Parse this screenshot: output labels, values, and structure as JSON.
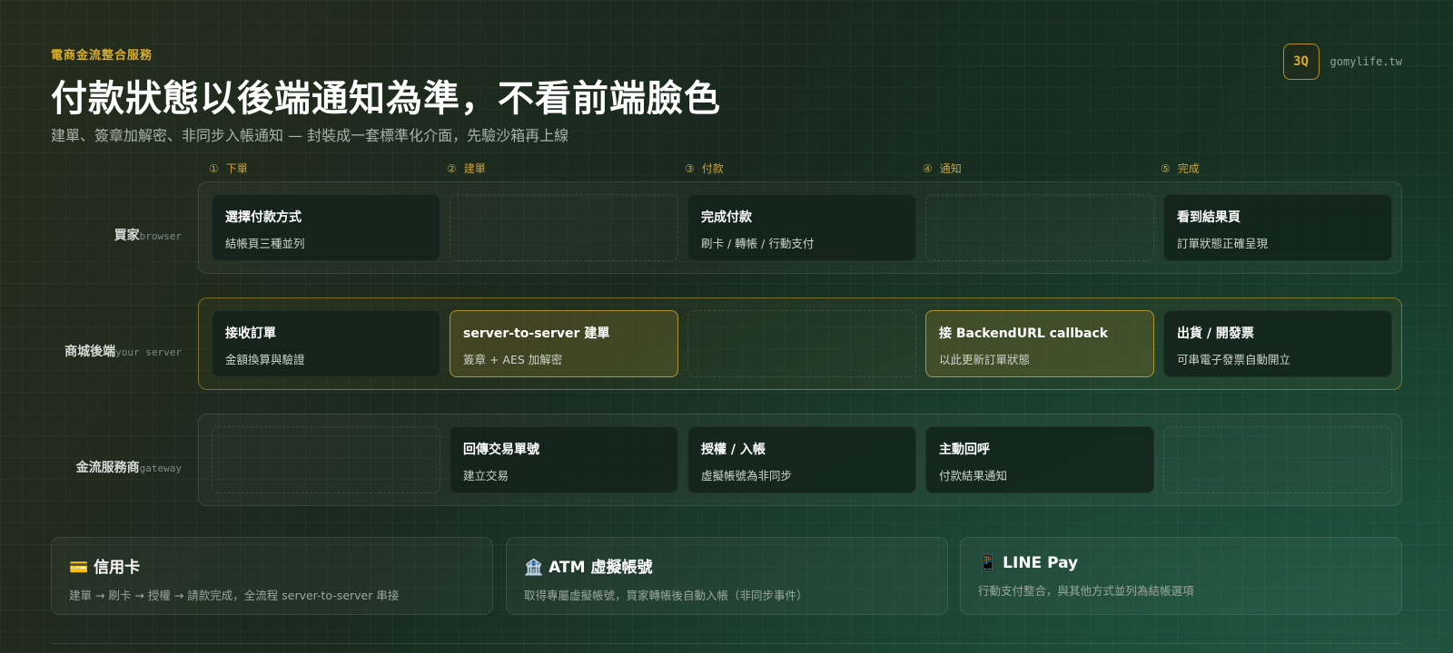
{
  "header": {
    "eyebrow": "電商金流整合服務",
    "title": "付款狀態以後端通知為準，不看前端臉色",
    "subtitle": "建單、簽章加解密、非同步入帳通知 — 封裝成一套標準化介面，先驗沙箱再上線"
  },
  "brand": {
    "logo": "3Q",
    "url": "gomylife.tw"
  },
  "steps": [
    {
      "num": "①",
      "label": "下單"
    },
    {
      "num": "②",
      "label": "建單"
    },
    {
      "num": "③",
      "label": "付款"
    },
    {
      "num": "④",
      "label": "通知"
    },
    {
      "num": "⑤",
      "label": "完成"
    }
  ],
  "lanes": [
    {
      "label": "買家",
      "sub": "browser",
      "cards": [
        {
          "title": "選擇付款方式",
          "desc": "結帳頁三種並列"
        },
        null,
        {
          "title": "完成付款",
          "desc": "刷卡 / 轉帳 / 行動支付"
        },
        null,
        {
          "title": "看到結果頁",
          "desc": "訂單狀態正確呈現"
        }
      ]
    },
    {
      "label": "商城後端",
      "sub": "your server",
      "cards": [
        {
          "title": "接收訂單",
          "desc": "金額換算與驗證"
        },
        {
          "title": "server-to-server 建單",
          "desc": "簽章 + AES 加解密"
        },
        null,
        {
          "title": "接 BackendURL callback",
          "desc": "以此更新訂單狀態"
        },
        {
          "title": "出貨 / 開發票",
          "desc": "可串電子發票自動開立"
        }
      ]
    },
    {
      "label": "金流服務商",
      "sub": "gateway",
      "cards": [
        null,
        {
          "title": "回傳交易單號",
          "desc": "建立交易"
        },
        {
          "title": "授權 / 入帳",
          "desc": "虛擬帳號為非同步"
        },
        {
          "title": "主動回呼",
          "desc": "付款結果通知"
        },
        null
      ]
    }
  ],
  "methods": [
    {
      "icon": "💳",
      "title": "信用卡",
      "desc": "建單 → 刷卡 → 授權 → 請款完成，全流程 server-to-server 串接"
    },
    {
      "icon": "🏦",
      "title": "ATM 虛擬帳號",
      "desc": "取得專屬虛擬帳號，買家轉帳後自動入帳（非同步事件）"
    },
    {
      "icon": "📱",
      "title": "LINE Pay",
      "desc": "行動支付整合，與其他方式並列為結帳選項"
    }
  ]
}
